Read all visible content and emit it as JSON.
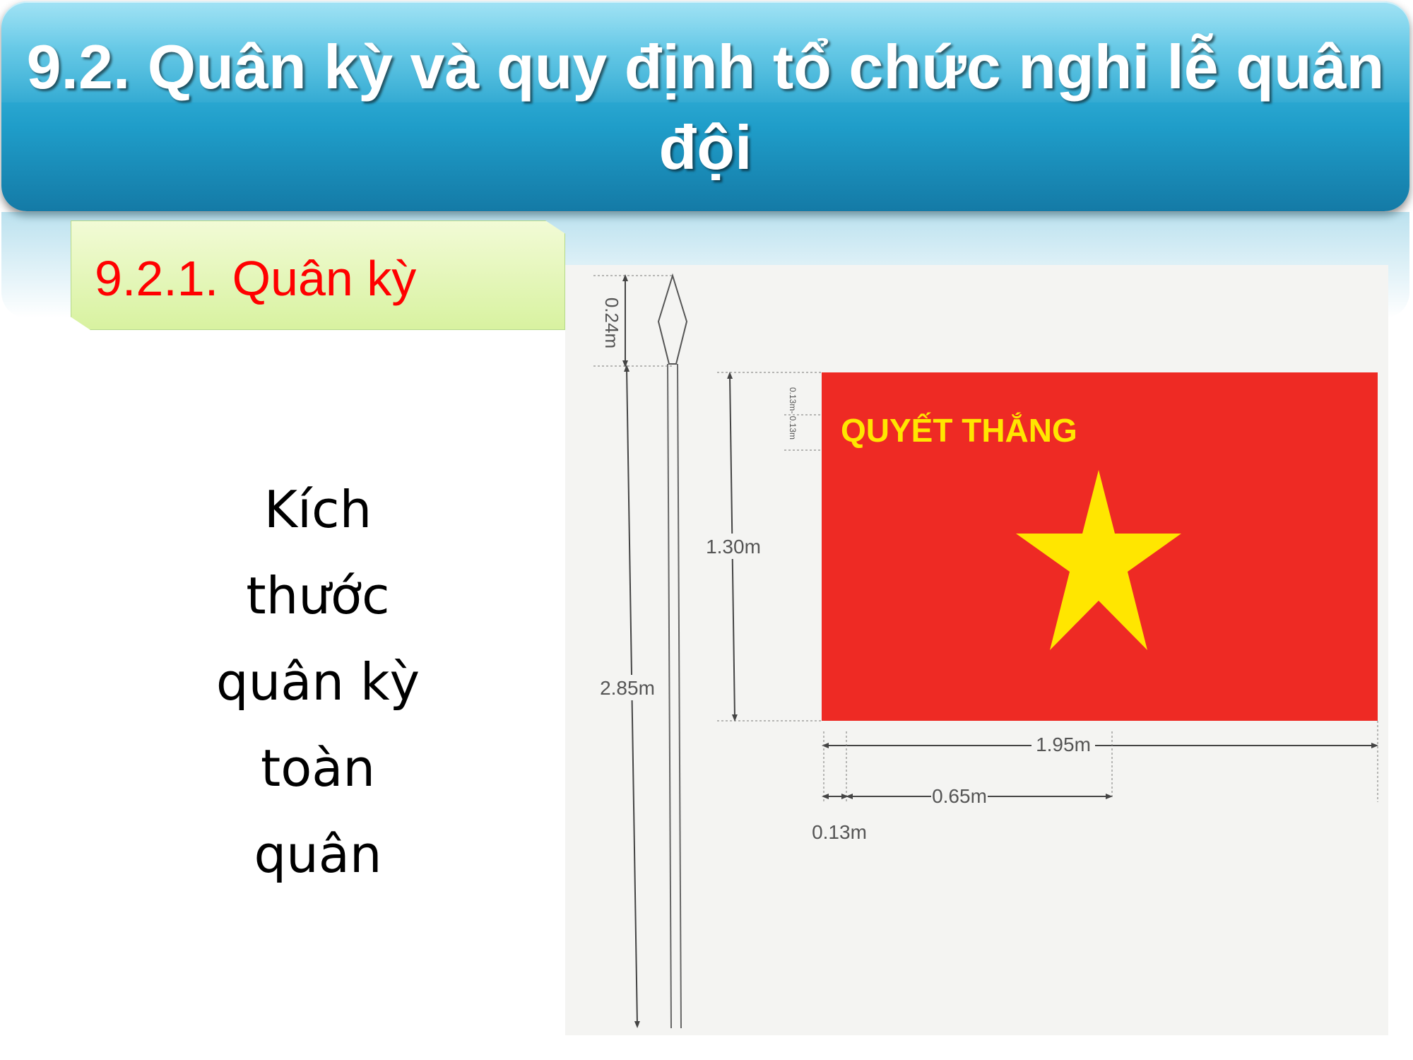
{
  "header": {
    "title": "9.2. Quân kỳ và quy định tổ chức nghi lễ quân đội"
  },
  "subsection": {
    "label": "9.2.1. Quân kỳ"
  },
  "body": {
    "lines": [
      "Kích",
      "thước",
      "quân kỳ",
      "toàn",
      "quân"
    ]
  },
  "diagram": {
    "flag_text": "QUYẾT THẮNG",
    "dimensions": {
      "spearhead": "0.24m",
      "pole": "2.85m",
      "flag_height": "1.30m",
      "text_band": "0.13m- 0.13m",
      "flag_width": "1.95m",
      "star_offset": "0.65m",
      "hoist_margin": "0.13m"
    },
    "colors": {
      "flag": "#ee2a24",
      "star": "#ffe600",
      "text": "#ffe600"
    }
  }
}
